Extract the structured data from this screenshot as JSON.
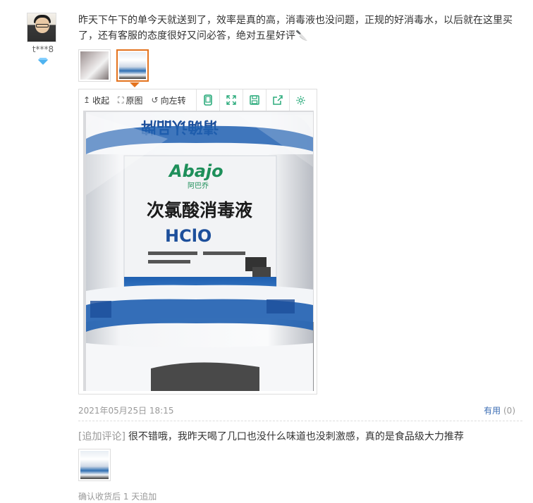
{
  "user": {
    "nickname": "t***8",
    "badge_icon": "diamond-icon"
  },
  "review": {
    "text": "昨天下午下的单今天就送到了，效率是真的高，消毒液也没问题，正规的好消毒水，以后就在这里买了，还有客服的态度很好又问必答，绝对五星好评🔪"
  },
  "viewer": {
    "toolbar": {
      "collapse": "收起",
      "original": "原图",
      "rotate_left": "向左转"
    },
    "product": {
      "brand": "Abajo",
      "brand_cn": "阿巴乔",
      "name": "次氯酸消毒液",
      "formula": "HClO",
      "top_text": "请确认品牌"
    }
  },
  "meta": {
    "date": "2021年05月25日 18:15",
    "useful_label": "有用",
    "useful_count": "(0)"
  },
  "append": {
    "tag": "[追加评论]",
    "text": "很不错哦，我昨天喝了几口也没什么味道也没刺激感，真的是食品级大力推荐",
    "confirm": "确认收货后 1 天追加"
  },
  "colors": {
    "accent": "#e4731e",
    "tool_green": "#2bab7c",
    "link": "#3c6eb4"
  }
}
